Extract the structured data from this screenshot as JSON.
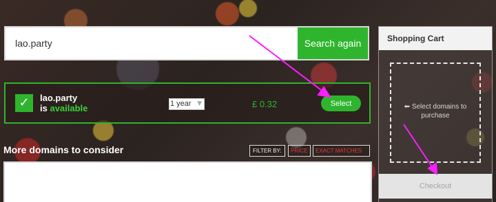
{
  "search": {
    "value": "lao.party",
    "button_label": "Search again"
  },
  "result": {
    "check_glyph": "✓",
    "domain": "lao.party",
    "status_prefix": "is",
    "status_word": "available",
    "term": "1 year",
    "price": "£ 0.32",
    "select_label": "Select"
  },
  "more": {
    "title": "More domains to consider",
    "filter_label": "FILTER BY:",
    "filters": [
      "PRICE",
      "EXACT MATCHES"
    ]
  },
  "cart": {
    "title": "Shopping Cart",
    "hint_icon": "arrow-left-icon",
    "hint_arrow": "⬅",
    "hint": "Select domains to purchase",
    "checkout_label": "Checkout"
  },
  "colors": {
    "accent_green": "#2fb52d",
    "annotation_magenta": "#ff1eff",
    "filter_red": "#e43b3b"
  }
}
